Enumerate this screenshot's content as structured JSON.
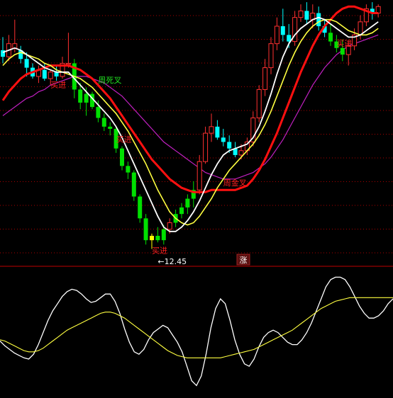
{
  "chart_data": [
    {
      "type": "candlestick",
      "panel": "price",
      "grid": true,
      "ylim": [
        8.5,
        20.5
      ],
      "colors": {
        "up": "#ff3030",
        "down_bright": "#00ffff",
        "down_green": "#00e000",
        "grid": "#aa0000",
        "ma_fast": "#ffffff",
        "ma_mid": "#ffff40",
        "ma_slow": "#ff1010",
        "ma_long": "#c020c0"
      },
      "candles": [
        {
          "o": 18.2,
          "h": 18.8,
          "l": 17.6,
          "c": 17.9,
          "color": "cyan"
        },
        {
          "o": 17.9,
          "h": 18.9,
          "l": 17.7,
          "c": 18.5,
          "color": "red"
        },
        {
          "o": 18.5,
          "h": 19.6,
          "l": 18.1,
          "c": 18.3,
          "color": "red"
        },
        {
          "o": 18.2,
          "h": 18.4,
          "l": 17.6,
          "c": 17.8,
          "color": "cyan"
        },
        {
          "o": 17.8,
          "h": 18.1,
          "l": 17.0,
          "c": 17.4,
          "color": "cyan"
        },
        {
          "o": 17.4,
          "h": 17.6,
          "l": 16.9,
          "c": 17.0,
          "color": "cyan"
        },
        {
          "o": 17.0,
          "h": 17.5,
          "l": 16.7,
          "c": 17.3,
          "color": "red"
        },
        {
          "o": 17.3,
          "h": 17.6,
          "l": 16.8,
          "c": 16.9,
          "color": "cyan"
        },
        {
          "o": 16.9,
          "h": 17.3,
          "l": 16.6,
          "c": 17.2,
          "color": "red"
        },
        {
          "o": 17.2,
          "h": 17.5,
          "l": 16.8,
          "c": 17.0,
          "color": "cyan"
        },
        {
          "o": 17.0,
          "h": 17.9,
          "l": 16.9,
          "c": 17.6,
          "color": "red"
        },
        {
          "o": 17.6,
          "h": 19.0,
          "l": 17.4,
          "c": 17.6,
          "color": "red"
        },
        {
          "o": 17.6,
          "h": 17.8,
          "l": 16.0,
          "c": 16.4,
          "color": "green"
        },
        {
          "o": 16.4,
          "h": 16.7,
          "l": 15.5,
          "c": 15.8,
          "color": "green"
        },
        {
          "o": 15.8,
          "h": 16.5,
          "l": 15.2,
          "c": 16.2,
          "color": "green"
        },
        {
          "o": 16.2,
          "h": 16.3,
          "l": 15.5,
          "c": 15.6,
          "color": "green"
        },
        {
          "o": 15.6,
          "h": 15.9,
          "l": 14.9,
          "c": 15.1,
          "color": "green"
        },
        {
          "o": 15.1,
          "h": 15.3,
          "l": 14.5,
          "c": 14.7,
          "color": "green"
        },
        {
          "o": 14.7,
          "h": 14.9,
          "l": 14.3,
          "c": 14.6,
          "color": "green"
        },
        {
          "o": 14.6,
          "h": 14.7,
          "l": 13.5,
          "c": 13.7,
          "color": "green"
        },
        {
          "o": 13.7,
          "h": 13.8,
          "l": 12.7,
          "c": 12.9,
          "color": "green"
        },
        {
          "o": 12.9,
          "h": 13.1,
          "l": 12.3,
          "c": 12.6,
          "color": "green"
        },
        {
          "o": 12.6,
          "h": 12.7,
          "l": 11.3,
          "c": 11.5,
          "color": "green"
        },
        {
          "o": 11.5,
          "h": 11.6,
          "l": 10.3,
          "c": 10.5,
          "color": "green"
        },
        {
          "o": 10.5,
          "h": 10.7,
          "l": 9.3,
          "c": 9.5,
          "color": "green"
        },
        {
          "o": 9.5,
          "h": 9.8,
          "l": 9.1,
          "c": 9.7,
          "color": "yellow"
        },
        {
          "o": 9.7,
          "h": 10.1,
          "l": 9.4,
          "c": 9.5,
          "color": "green"
        },
        {
          "o": 9.5,
          "h": 10.2,
          "l": 9.3,
          "c": 10.0,
          "color": "green"
        },
        {
          "o": 10.0,
          "h": 10.5,
          "l": 9.8,
          "c": 10.3,
          "color": "red"
        },
        {
          "o": 10.3,
          "h": 10.9,
          "l": 10.1,
          "c": 10.7,
          "color": "green"
        },
        {
          "o": 10.7,
          "h": 11.2,
          "l": 10.5,
          "c": 11.0,
          "color": "green"
        },
        {
          "o": 11.0,
          "h": 11.6,
          "l": 10.7,
          "c": 11.4,
          "color": "green"
        },
        {
          "o": 11.4,
          "h": 12.2,
          "l": 11.0,
          "c": 11.8,
          "color": "green"
        },
        {
          "o": 11.8,
          "h": 13.4,
          "l": 11.6,
          "c": 13.1,
          "color": "red"
        },
        {
          "o": 13.1,
          "h": 14.7,
          "l": 13.0,
          "c": 14.4,
          "color": "red"
        },
        {
          "o": 14.4,
          "h": 15.3,
          "l": 14.0,
          "c": 14.7,
          "color": "red"
        },
        {
          "o": 14.7,
          "h": 15.0,
          "l": 14.1,
          "c": 14.2,
          "color": "cyan"
        },
        {
          "o": 14.2,
          "h": 14.6,
          "l": 13.8,
          "c": 14.0,
          "color": "cyan"
        },
        {
          "o": 14.0,
          "h": 14.3,
          "l": 13.5,
          "c": 13.7,
          "color": "cyan"
        },
        {
          "o": 13.7,
          "h": 14.0,
          "l": 13.3,
          "c": 13.4,
          "color": "cyan"
        },
        {
          "o": 13.4,
          "h": 13.9,
          "l": 13.2,
          "c": 13.6,
          "color": "red"
        },
        {
          "o": 13.6,
          "h": 14.2,
          "l": 13.4,
          "c": 14.0,
          "color": "red"
        },
        {
          "o": 14.0,
          "h": 15.4,
          "l": 13.8,
          "c": 15.1,
          "color": "red"
        },
        {
          "o": 15.1,
          "h": 16.6,
          "l": 14.9,
          "c": 16.4,
          "color": "red"
        },
        {
          "o": 16.4,
          "h": 17.8,
          "l": 16.1,
          "c": 17.4,
          "color": "red"
        },
        {
          "o": 17.4,
          "h": 18.8,
          "l": 17.1,
          "c": 18.5,
          "color": "red"
        },
        {
          "o": 18.5,
          "h": 19.7,
          "l": 18.2,
          "c": 19.3,
          "color": "red"
        },
        {
          "o": 19.3,
          "h": 20.1,
          "l": 18.6,
          "c": 18.9,
          "color": "cyan"
        },
        {
          "o": 18.9,
          "h": 19.4,
          "l": 18.3,
          "c": 18.6,
          "color": "cyan"
        },
        {
          "o": 18.6,
          "h": 20.0,
          "l": 18.4,
          "c": 19.7,
          "color": "red"
        },
        {
          "o": 19.7,
          "h": 20.3,
          "l": 19.5,
          "c": 20.0,
          "color": "red"
        },
        {
          "o": 20.0,
          "h": 20.4,
          "l": 19.4,
          "c": 19.6,
          "color": "cyan"
        },
        {
          "o": 19.6,
          "h": 20.3,
          "l": 19.2,
          "c": 19.9,
          "color": "red"
        },
        {
          "o": 19.9,
          "h": 20.2,
          "l": 19.1,
          "c": 19.3,
          "color": "cyan"
        },
        {
          "o": 19.3,
          "h": 19.6,
          "l": 18.8,
          "c": 19.0,
          "color": "cyan"
        },
        {
          "o": 19.0,
          "h": 19.4,
          "l": 18.4,
          "c": 18.6,
          "color": "green"
        },
        {
          "o": 18.6,
          "h": 18.9,
          "l": 18.1,
          "c": 18.3,
          "color": "green"
        },
        {
          "o": 18.3,
          "h": 18.7,
          "l": 17.7,
          "c": 18.0,
          "color": "green"
        },
        {
          "o": 18.0,
          "h": 18.6,
          "l": 17.5,
          "c": 18.4,
          "color": "red"
        },
        {
          "o": 18.4,
          "h": 19.2,
          "l": 18.2,
          "c": 18.9,
          "color": "red"
        },
        {
          "o": 18.9,
          "h": 19.8,
          "l": 18.7,
          "c": 19.5,
          "color": "red"
        },
        {
          "o": 19.5,
          "h": 20.3,
          "l": 19.3,
          "c": 20.1,
          "color": "red"
        },
        {
          "o": 20.1,
          "h": 20.4,
          "l": 19.6,
          "c": 19.9,
          "color": "cyan"
        },
        {
          "o": 19.9,
          "h": 20.3,
          "l": 19.7,
          "c": 20.2,
          "color": "red"
        }
      ],
      "ma_white": [
        18.1,
        18.2,
        18.3,
        18.2,
        18.0,
        17.8,
        17.6,
        17.4,
        17.3,
        17.2,
        17.2,
        17.2,
        16.9,
        16.6,
        16.3,
        16.0,
        15.7,
        15.4,
        15.1,
        14.7,
        14.2,
        13.6,
        13.0,
        12.4,
        11.8,
        11.2,
        10.6,
        10.1,
        9.9,
        9.9,
        10.1,
        10.4,
        10.8,
        11.3,
        11.9,
        12.5,
        13.0,
        13.4,
        13.6,
        13.7,
        13.8,
        13.9,
        14.2,
        14.7,
        15.4,
        16.2,
        17.1,
        17.9,
        18.5,
        18.9,
        19.2,
        19.4,
        19.6,
        19.7,
        19.6,
        19.4,
        19.2,
        19.0,
        18.8,
        18.8,
        18.9,
        19.1,
        19.3,
        19.5
      ],
      "ma_yellow": [
        17.5,
        17.8,
        18.0,
        18.1,
        18.0,
        17.9,
        17.8,
        17.6,
        17.5,
        17.3,
        17.2,
        17.1,
        17.0,
        16.9,
        16.7,
        16.5,
        16.2,
        15.9,
        15.6,
        15.3,
        14.9,
        14.5,
        14.0,
        13.5,
        13.0,
        12.4,
        11.8,
        11.3,
        10.8,
        10.5,
        10.3,
        10.2,
        10.3,
        10.6,
        11.0,
        11.4,
        11.9,
        12.3,
        12.7,
        13.0,
        13.3,
        13.6,
        13.9,
        14.3,
        14.8,
        15.4,
        16.1,
        16.8,
        17.5,
        18.1,
        18.6,
        19.0,
        19.3,
        19.5,
        19.6,
        19.6,
        19.5,
        19.3,
        19.1,
        19.0,
        18.9,
        18.9,
        19.0,
        19.2
      ],
      "ma_red": [
        15.9,
        16.3,
        16.6,
        16.9,
        17.1,
        17.2,
        17.3,
        17.4,
        17.5,
        17.5,
        17.5,
        17.5,
        17.4,
        17.3,
        17.1,
        16.9,
        16.6,
        16.3,
        16.0,
        15.6,
        15.2,
        14.8,
        14.4,
        14.0,
        13.6,
        13.2,
        12.9,
        12.6,
        12.3,
        12.1,
        11.9,
        11.8,
        11.7,
        11.7,
        11.7,
        11.8,
        11.8,
        11.8,
        11.8,
        11.8,
        11.9,
        12.0,
        12.3,
        12.7,
        13.2,
        13.8,
        14.4,
        15.1,
        15.8,
        16.5,
        17.2,
        17.8,
        18.4,
        18.9,
        19.3,
        19.6,
        19.9,
        20.1,
        20.2,
        20.2,
        20.1,
        20.0,
        19.9,
        19.9
      ],
      "ma_purple": [
        15.2,
        15.4,
        15.6,
        15.8,
        16.0,
        16.1,
        16.3,
        16.4,
        16.6,
        16.7,
        16.8,
        16.9,
        17.0,
        17.0,
        17.0,
        16.9,
        16.8,
        16.7,
        16.5,
        16.3,
        16.1,
        15.8,
        15.5,
        15.2,
        14.9,
        14.6,
        14.3,
        14.0,
        13.8,
        13.6,
        13.4,
        13.2,
        13.0,
        12.8,
        12.6,
        12.5,
        12.4,
        12.3,
        12.3,
        12.3,
        12.4,
        12.5,
        12.6,
        12.8,
        13.0,
        13.3,
        13.7,
        14.1,
        14.6,
        15.1,
        15.6,
        16.1,
        16.6,
        17.0,
        17.4,
        17.7,
        18.0,
        18.2,
        18.4,
        18.5,
        18.6,
        18.7,
        18.8,
        18.9
      ],
      "annotations": [
        {
          "text": "买进",
          "i": 8,
          "y": 16.5,
          "color": "red"
        },
        {
          "text": "周死叉",
          "i": 16,
          "y": 16.7,
          "color": "green"
        },
        {
          "text": "买进",
          "i": 19,
          "y": 14.0,
          "color": "red"
        },
        {
          "text": "周金叉",
          "i": 37,
          "y": 12.0,
          "color": "red"
        },
        {
          "text": "买进",
          "i": 56,
          "y": 18.4,
          "color": "red"
        },
        {
          "text": "买进",
          "i": 25,
          "y": 8.9,
          "color": "red"
        },
        {
          "text": "←12.45",
          "i": 26,
          "y": 8.4,
          "color": "white"
        }
      ],
      "marker_label": "涨"
    },
    {
      "type": "line",
      "panel": "oscillator",
      "grid": false,
      "ylim": [
        0,
        100
      ],
      "series": [
        {
          "color": "#ffffff",
          "values": [
            45,
            41,
            38,
            35,
            33,
            31,
            30,
            34,
            42,
            52,
            62,
            70,
            76,
            82,
            86,
            88,
            87,
            84,
            80,
            77,
            78,
            81,
            84,
            84,
            78,
            68,
            55,
            44,
            36,
            34,
            38,
            46,
            52,
            55,
            58,
            56,
            50,
            44,
            36,
            24,
            12,
            8,
            16,
            34,
            56,
            72,
            80,
            76,
            62,
            46,
            34,
            26,
            24,
            30,
            40,
            48,
            52,
            54,
            52,
            48,
            44,
            42,
            42,
            46,
            52,
            60,
            70,
            80,
            90,
            96,
            98,
            98,
            96,
            90,
            82,
            74,
            68,
            64,
            64,
            66,
            70,
            76,
            80
          ]
        },
        {
          "color": "#ffff40",
          "values": [
            46,
            45,
            43,
            41,
            39,
            37,
            36,
            36,
            37,
            39,
            42,
            45,
            48,
            51,
            54,
            56,
            58,
            60,
            62,
            64,
            66,
            68,
            69,
            69,
            68,
            66,
            64,
            61,
            58,
            55,
            52,
            49,
            46,
            43,
            40,
            37,
            35,
            33,
            32,
            31,
            31,
            31,
            31,
            31,
            31,
            31,
            31,
            32,
            33,
            34,
            35,
            36,
            37,
            38,
            40,
            42,
            44,
            46,
            48,
            50,
            52,
            54,
            57,
            60,
            63,
            66,
            69,
            72,
            74,
            76,
            78,
            79,
            80,
            81,
            81,
            81,
            81,
            81,
            81,
            81,
            81,
            81,
            81
          ]
        }
      ]
    }
  ]
}
